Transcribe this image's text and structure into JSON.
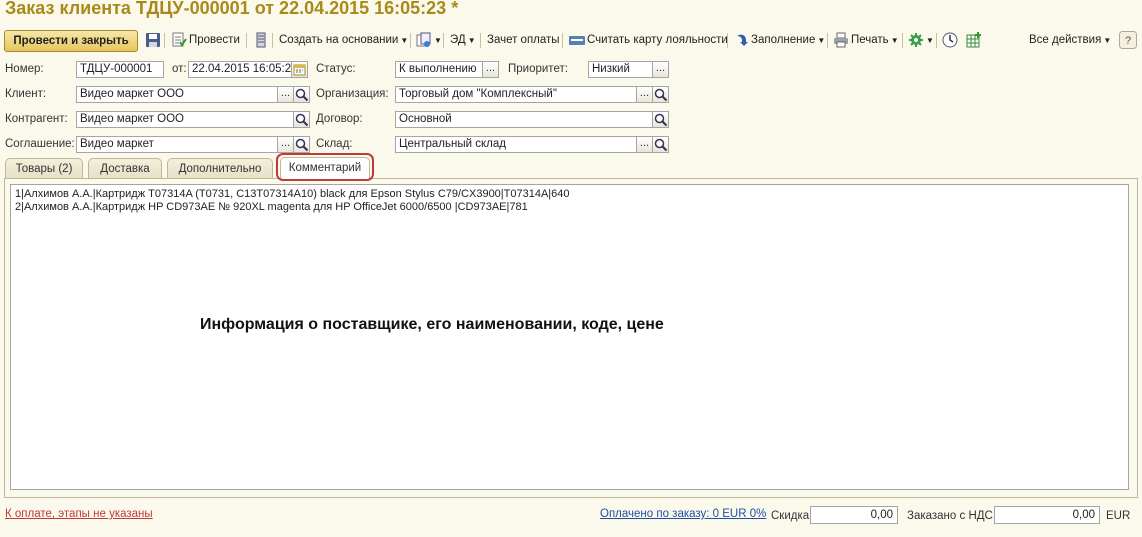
{
  "window": {
    "title": "Заказ клиента ТДЦУ-000001 от 22.04.2015 16:05:23 *"
  },
  "toolbar": {
    "post_close": "Провести и закрыть",
    "post": "Провести",
    "create_based": "Создать на основании",
    "ed": "ЭД",
    "payment_offset": "Зачет оплаты",
    "loyalty_card": "Считать карту лояльности",
    "fill": "Заполнение",
    "print": "Печать",
    "all_actions": "Все действия"
  },
  "form": {
    "number_label": "Номер:",
    "number_value": "ТДЦУ-000001",
    "from_label": "от:",
    "date_value": "22.04.2015 16:05:23",
    "status_label": "Статус:",
    "status_value": "К выполнению",
    "priority_label": "Приоритет:",
    "priority_value": "Низкий",
    "client_label": "Клиент:",
    "client_value": "Видео маркет ООО",
    "org_label": "Организация:",
    "org_value": "Торговый дом \"Комплексный\"",
    "contractor_label": "Контрагент:",
    "contractor_value": "Видео маркет ООО",
    "contract_label": "Договор:",
    "contract_value": "Основной",
    "agreement_label": "Соглашение:",
    "agreement_value": "Видео маркет",
    "warehouse_label": "Склад:",
    "warehouse_value": "Центральный склад",
    "select_btn": "..."
  },
  "tabs": [
    {
      "label": "Товары (2)"
    },
    {
      "label": "Доставка"
    },
    {
      "label": "Дополнительно"
    },
    {
      "label": "Комментарий"
    }
  ],
  "comment": {
    "lines": [
      "1|Алхимов А.А.|Картридж T07314A (T0731, C13T07314A10) black для Epson Stylus  C79/CX3900|T07314A|640",
      "2|Алхимов А.А.|Картридж HP CD973AE № 920XL magenta для HP OfficeJet 6000/6500  |CD973AE|781"
    ]
  },
  "annotation": "Информация о поставщике, его наименовании, коде, цене",
  "footer": {
    "payment_link": "К оплате, этапы не указаны",
    "paid_link": "Оплачено по заказу: 0 EUR  0%",
    "discount_label": "Скидка:",
    "discount_value": "0,00",
    "ordered_vat_label": "Заказано с НДС:",
    "ordered_vat_value": "0,00",
    "currency": "EUR"
  },
  "colors": {
    "title": "#a88a1a",
    "highlight": "#c0393b",
    "link": "#1f4ea8",
    "background": "#fbf9ec"
  }
}
